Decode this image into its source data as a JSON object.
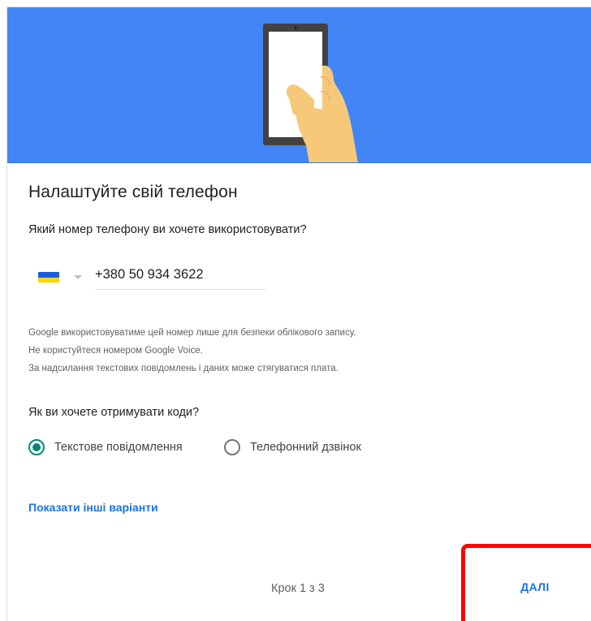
{
  "colors": {
    "hero_background": "#4285f4",
    "link_blue": "#1a73e8",
    "radio_selected": "#00897b",
    "highlight_red": "#ff0000",
    "flag_blue": "#1e5bd6",
    "flag_yellow": "#ffd500"
  },
  "hero": {
    "illustration": "hand-holding-phone-icon"
  },
  "setup": {
    "title": "Налаштуйте свій телефон",
    "phone_question": "Який номер телефону ви хочете використовувати?",
    "country_flag": "ukraine-flag-icon",
    "phone_number": "+380 50 934 3622",
    "notes": [
      "Google використовуватиме цей номер лише для безпеки облікового запису.",
      "Не користуйтеся номером Google Voice.",
      "За надсилання текстових повідомлень і даних може стягуватися плата."
    ],
    "codes_question": "Як ви хочете отримувати коди?",
    "options": [
      {
        "label": "Текстове повідомлення",
        "selected": true
      },
      {
        "label": "Телефонний дзвінок",
        "selected": false
      }
    ],
    "more_options_link": "Показати інші варіанти"
  },
  "footer": {
    "step_text": "Крок 1 з 3",
    "next_label": "ДАЛІ"
  }
}
